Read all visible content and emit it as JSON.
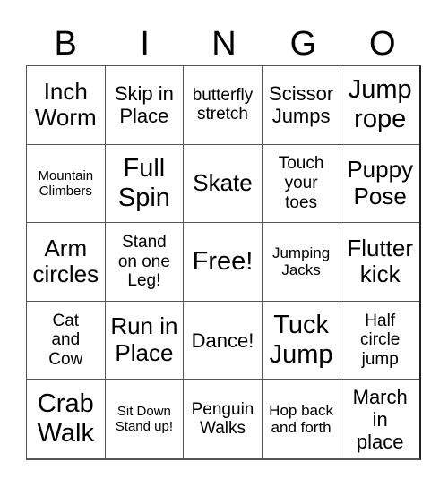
{
  "header": {
    "letters": [
      "B",
      "I",
      "N",
      "G",
      "O"
    ]
  },
  "board": {
    "rows": [
      [
        "Inch\nWorm",
        "Skip in\nPlace",
        "butterfly\nstretch",
        "Scissor\nJumps",
        "Jump\nrope"
      ],
      [
        "Mountain\nClimbers",
        "Full\nSpin",
        "Skate",
        "Touch\nyour\ntoes",
        "Puppy\nPose"
      ],
      [
        "Arm\ncircles",
        "Stand\non one\nLeg!",
        "Free!",
        "Jumping\nJacks",
        "Flutter\nkick"
      ],
      [
        "Cat\nand\nCow",
        "Run in\nPlace",
        "Dance!",
        "Tuck\nJump",
        "Half\ncircle\njump"
      ],
      [
        "Crab\nWalk",
        "Sit Down\nStand up!",
        "Penguin\nWalks",
        "Hop back\nand forth",
        "March\nin\nplace"
      ]
    ]
  }
}
